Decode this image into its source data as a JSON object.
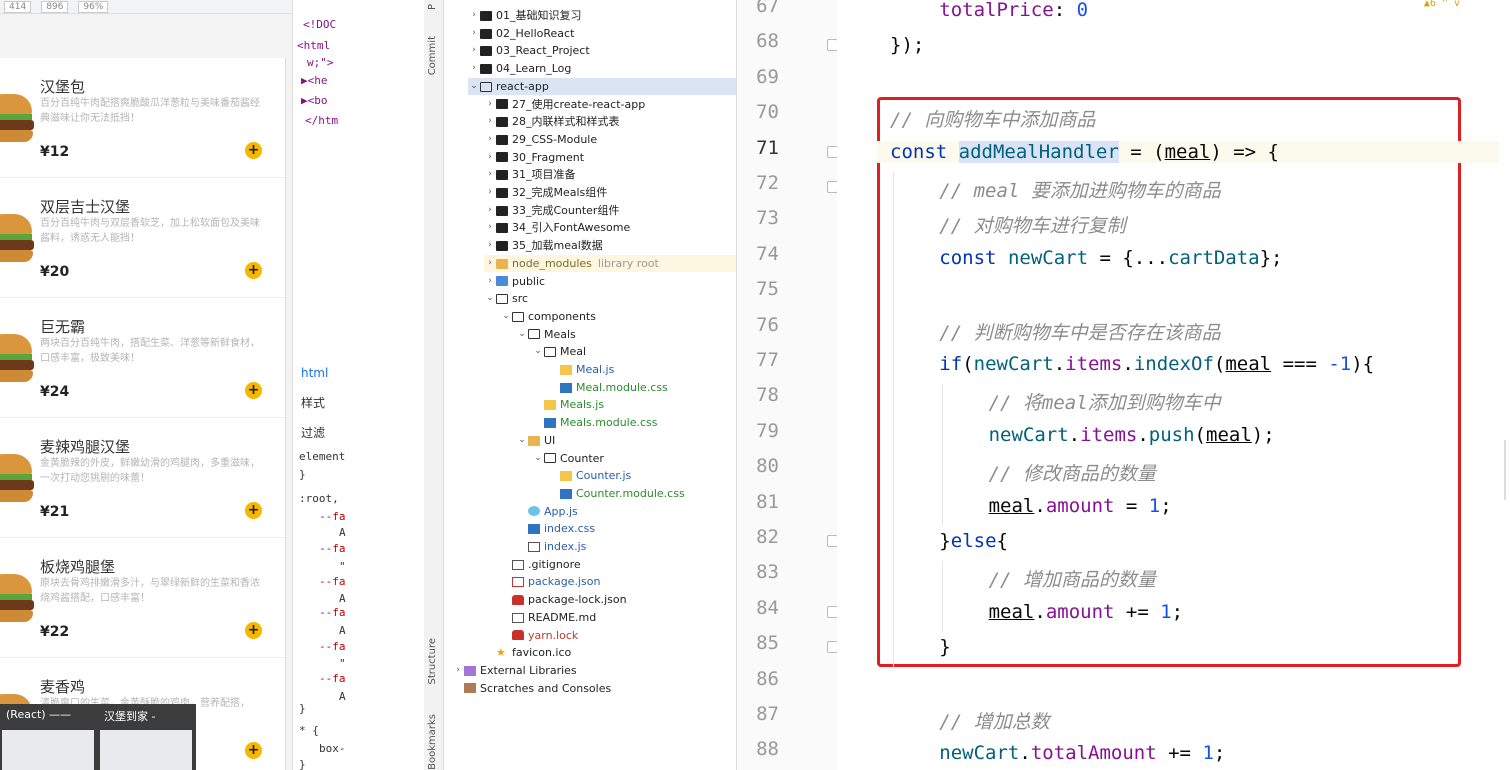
{
  "app": {
    "topbar": [
      "414",
      "896",
      "96%"
    ],
    "meals": [
      {
        "name": "汉堡包",
        "desc": "百分百纯牛肉配搭爽脆酸瓜洋葱粒与美味番茄酱经典滋味让你无法抵挡！",
        "price": "¥12"
      },
      {
        "name": "双层吉士汉堡",
        "desc": "百分百纯牛肉与双层香软芝，加上松软面包及美味酱料，诱惑无人能挡！",
        "price": "¥20"
      },
      {
        "name": "巨无霸",
        "desc": "两块百分百纯牛肉，搭配生菜、洋葱等新鲜食材，口感丰富，极致美味！",
        "price": "¥24"
      },
      {
        "name": "麦辣鸡腿汉堡",
        "desc": "金黄脆辣的外皮，鲜嫩幼滑的鸡腿肉，多重滋味，一次打动您挑剔的味蕾！",
        "price": "¥21"
      },
      {
        "name": "板烧鸡腿堡",
        "desc": "原块去骨鸡排嫩滑多汁，与翠绿新鲜的生菜和香浓烧鸡酱搭配，口感丰富！",
        "price": "¥22"
      },
      {
        "name": "麦香鸡",
        "desc": "清脆爽口的生菜，金黄酥脆的鸡肉。营养配搭，",
        "price": ""
      }
    ],
    "add_symbol": "+",
    "taskbar": {
      "left_label": "(React) ——",
      "right_label": "汉堡到家 -"
    }
  },
  "devtools": {
    "lines": [
      "<!DOC",
      "<html",
      "w;\">",
      "▶<he",
      "▶<bo",
      "</htm"
    ],
    "tab_html": "html",
    "tab_styles": "样式",
    "tab_filter": "过滤",
    "styles": [
      "element",
      "}",
      ":root,",
      "--fa",
      "A",
      "--fa",
      "\"",
      "--fa",
      "A",
      "--fa",
      "A",
      "--fa",
      "\"",
      "--fa",
      "A",
      "}",
      "* {",
      "box-",
      "}"
    ]
  },
  "vtool": {
    "commit": "Commit",
    "structure": "Structure",
    "bookmarks": "Bookmarks",
    "project": "P"
  },
  "tree": {
    "items": [
      {
        "label": "01_基础知识复习",
        "indent": 1,
        "icon": "folder",
        "arrow": "›"
      },
      {
        "label": "02_HelloReact",
        "indent": 1,
        "icon": "folder",
        "arrow": "›"
      },
      {
        "label": "03_React_Project",
        "indent": 1,
        "icon": "folder",
        "arrow": "›"
      },
      {
        "label": "04_Learn_Log",
        "indent": 1,
        "icon": "folder",
        "arrow": "›"
      },
      {
        "label": "react-app",
        "indent": 1,
        "icon": "ofolder",
        "arrow": "⌄",
        "sel": true
      },
      {
        "label": "27_使用create-react-app",
        "indent": 2,
        "icon": "folder",
        "arrow": "›"
      },
      {
        "label": "28_内联样式和样式表",
        "indent": 2,
        "icon": "folder",
        "arrow": "›"
      },
      {
        "label": "29_CSS-Module",
        "indent": 2,
        "icon": "folder",
        "arrow": "›"
      },
      {
        "label": "30_Fragment",
        "indent": 2,
        "icon": "folder",
        "arrow": "›"
      },
      {
        "label": "31_项目准备",
        "indent": 2,
        "icon": "folder",
        "arrow": "›"
      },
      {
        "label": "32_完成Meals组件",
        "indent": 2,
        "icon": "folder",
        "arrow": "›"
      },
      {
        "label": "33_完成Counter组件",
        "indent": 2,
        "icon": "folder",
        "arrow": "›"
      },
      {
        "label": "34_引入FontAwesome",
        "indent": 2,
        "icon": "folder",
        "arrow": "›"
      },
      {
        "label": "35_加载meal数据",
        "indent": 2,
        "icon": "folder",
        "arrow": "›"
      },
      {
        "label": "node_modules",
        "indent": 2,
        "icon": "yfolder",
        "arrow": "›",
        "cls": "lbl-lib",
        "extra": "library root",
        "lib": true
      },
      {
        "label": "public",
        "indent": 2,
        "icon": "bfolder",
        "arrow": "›"
      },
      {
        "label": "src",
        "indent": 2,
        "icon": "ofolder",
        "arrow": "⌄"
      },
      {
        "label": "components",
        "indent": 3,
        "icon": "ofolder",
        "arrow": "⌄"
      },
      {
        "label": "Meals",
        "indent": 4,
        "icon": "ofolder",
        "arrow": "⌄"
      },
      {
        "label": "Meal",
        "indent": 5,
        "icon": "ofolder",
        "arrow": "⌄"
      },
      {
        "label": "Meal.js",
        "indent": 6,
        "icon": "js",
        "arrow": "",
        "cls": "lbl-blue"
      },
      {
        "label": "Meal.module.css",
        "indent": 6,
        "icon": "css",
        "arrow": "",
        "cls": "lbl-green"
      },
      {
        "label": "Meals.js",
        "indent": 5,
        "icon": "js",
        "arrow": "",
        "cls": "lbl-green"
      },
      {
        "label": "Meals.module.css",
        "indent": 5,
        "icon": "css",
        "arrow": "",
        "cls": "lbl-green"
      },
      {
        "label": "UI",
        "indent": 4,
        "icon": "yfolder",
        "arrow": "⌄"
      },
      {
        "label": "Counter",
        "indent": 5,
        "icon": "ofolder",
        "arrow": "⌄"
      },
      {
        "label": "Counter.js",
        "indent": 6,
        "icon": "js",
        "arrow": "",
        "cls": "lbl-blue"
      },
      {
        "label": "Counter.module.css",
        "indent": 6,
        "icon": "css",
        "arrow": "",
        "cls": "lbl-green"
      },
      {
        "label": "App.js",
        "indent": 4,
        "icon": "react",
        "arrow": "",
        "cls": "lbl-blue"
      },
      {
        "label": "index.css",
        "indent": 4,
        "icon": "css",
        "arrow": "",
        "cls": "lbl-blue"
      },
      {
        "label": "index.js",
        "indent": 4,
        "icon": "md",
        "arrow": "",
        "cls": "lbl-blue"
      },
      {
        "label": ".gitignore",
        "indent": 3,
        "icon": "md",
        "arrow": ""
      },
      {
        "label": "package.json",
        "indent": 3,
        "icon": "json",
        "arrow": "",
        "cls": "lbl-blue"
      },
      {
        "label": "package-lock.json",
        "indent": 3,
        "icon": "lock",
        "arrow": ""
      },
      {
        "label": "README.md",
        "indent": 3,
        "icon": "md",
        "arrow": ""
      },
      {
        "label": "yarn.lock",
        "indent": 3,
        "icon": "lock",
        "arrow": "",
        "cls": "lbl-red"
      },
      {
        "label": "favicon.ico",
        "indent": 2,
        "icon": "star",
        "arrow": ""
      },
      {
        "label": "External Libraries",
        "indent": 0,
        "icon": "lib",
        "arrow": "›"
      },
      {
        "label": "Scratches and Consoles",
        "indent": 0,
        "icon": "scratch",
        "arrow": ""
      }
    ]
  },
  "editor": {
    "line_numbers": [
      "67",
      "68",
      "69",
      "70",
      "71",
      "72",
      "73",
      "74",
      "75",
      "76",
      "77",
      "78",
      "79",
      "80",
      "81",
      "82",
      "83",
      "84",
      "85",
      "86",
      "87",
      "88"
    ],
    "current_line": "71",
    "warning": "▲6 ^ v",
    "code": [
      {
        "indent": 1,
        "tokens": [
          [
            "prop",
            "totalPrice"
          ],
          [
            "",
            ": "
          ],
          [
            "num",
            "0"
          ]
        ]
      },
      {
        "indent": 0,
        "tokens": [
          [
            "",
            "});"
          ]
        ]
      },
      {
        "indent": 0,
        "tokens": []
      },
      {
        "indent": 0,
        "tokens": [
          [
            "cm",
            "// 向购物车中添加商品"
          ]
        ]
      },
      {
        "indent": 0,
        "cur": true,
        "tokens": [
          [
            "kw",
            "const "
          ],
          [
            "fn hl",
            "addMealHandler"
          ],
          [
            "",
            " = ("
          ],
          [
            "ul",
            "meal"
          ],
          [
            "",
            ") => {"
          ]
        ]
      },
      {
        "indent": 1,
        "tokens": [
          [
            "cm",
            "// meal 要添加进购物车的商品"
          ]
        ]
      },
      {
        "indent": 1,
        "tokens": [
          [
            "cm",
            "// 对购物车进行复制"
          ]
        ]
      },
      {
        "indent": 1,
        "tokens": [
          [
            "kw",
            "const "
          ],
          [
            "fn",
            "newCart"
          ],
          [
            "",
            " = {..."
          ],
          [
            "fn",
            "cartData"
          ],
          [
            "",
            "};"
          ]
        ]
      },
      {
        "indent": 0,
        "tokens": []
      },
      {
        "indent": 1,
        "tokens": [
          [
            "cm",
            "// 判断购物车中是否存在该商品"
          ]
        ]
      },
      {
        "indent": 1,
        "tokens": [
          [
            "kw",
            "if"
          ],
          [
            "",
            "("
          ],
          [
            "fn",
            "newCart"
          ],
          [
            "",
            "."
          ],
          [
            "prop",
            "items"
          ],
          [
            "",
            "."
          ],
          [
            "fn",
            "indexOf"
          ],
          [
            "",
            "("
          ],
          [
            "ul",
            "meal"
          ],
          [
            "",
            " === "
          ],
          [
            "num",
            "-1"
          ],
          [
            "",
            ""
          ],
          [
            "",
            "){"
          ]
        ]
      },
      {
        "indent": 2,
        "tokens": [
          [
            "cm",
            "// 将meal添加到购物车中"
          ]
        ]
      },
      {
        "indent": 2,
        "tokens": [
          [
            "fn",
            "newCart"
          ],
          [
            "",
            "."
          ],
          [
            "prop",
            "items"
          ],
          [
            "",
            "."
          ],
          [
            "fn",
            "push"
          ],
          [
            "",
            "("
          ],
          [
            "ul",
            "meal"
          ],
          [
            "",
            ");"
          ]
        ]
      },
      {
        "indent": 2,
        "tokens": [
          [
            "cm",
            "// 修改商品的数量"
          ]
        ]
      },
      {
        "indent": 2,
        "tokens": [
          [
            "ul",
            "meal"
          ],
          [
            "",
            "."
          ],
          [
            "prop",
            "amount"
          ],
          [
            "",
            " = "
          ],
          [
            "num",
            "1"
          ],
          [
            "",
            ";"
          ]
        ]
      },
      {
        "indent": 1,
        "tokens": [
          [
            "",
            "}"
          ],
          [
            "kw",
            "else"
          ],
          [
            "",
            "{"
          ]
        ]
      },
      {
        "indent": 2,
        "tokens": [
          [
            "cm",
            "// 增加商品的数量"
          ]
        ]
      },
      {
        "indent": 2,
        "tokens": [
          [
            "ul",
            "meal"
          ],
          [
            "",
            "."
          ],
          [
            "prop",
            "amount"
          ],
          [
            "",
            " += "
          ],
          [
            "num",
            "1"
          ],
          [
            "",
            ";"
          ]
        ]
      },
      {
        "indent": 1,
        "tokens": [
          [
            "",
            "}"
          ]
        ]
      },
      {
        "indent": 0,
        "tokens": []
      },
      {
        "indent": 1,
        "tokens": [
          [
            "cm",
            "// 增加总数"
          ]
        ]
      },
      {
        "indent": 1,
        "tokens": [
          [
            "fn",
            "newCart"
          ],
          [
            "",
            "."
          ],
          [
            "prop",
            "totalAmount"
          ],
          [
            "",
            " += "
          ],
          [
            "num",
            "1"
          ],
          [
            "",
            ";"
          ]
        ]
      }
    ]
  }
}
